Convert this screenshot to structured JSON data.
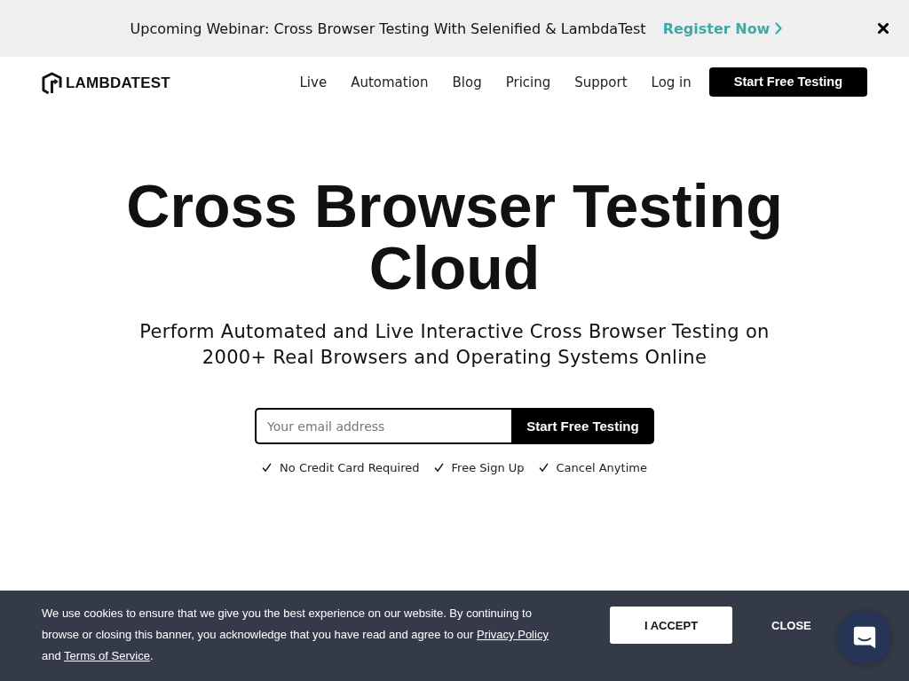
{
  "announcement_bar": {
    "text": "Upcoming Webinar: Cross Browser Testing With Selenified & LambdaTest",
    "link": "Register Now"
  },
  "header": {
    "logo": "LAMBDATEST",
    "nav": [
      {
        "label": "Live"
      },
      {
        "label": "Automation"
      },
      {
        "label": "Blog"
      },
      {
        "label": "Pricing"
      },
      {
        "label": "Support"
      },
      {
        "label": "Log in"
      }
    ],
    "cta": "Start Free Testing"
  },
  "hero": {
    "title": "Cross Browser Testing Cloud",
    "subtitle": "Perform Automated and Live Interactive Cross Browser Testing on 2000+ Real Browsers and Operating Systems Online",
    "signup": {
      "placeholder": "Your email address",
      "button": "Start Free Testing"
    },
    "perks": [
      "No Credit Card Required",
      "Free Sign Up",
      "Cancel Anytime"
    ]
  },
  "cookie_banner": {
    "text": [
      {
        "kind": "text",
        "text": "We use cookies to ensure that we give you the best experience on our website. By continuing to browse or closing this banner, you acknowledge that you have read and agree to our "
      },
      {
        "kind": "link",
        "text": "Privacy Policy"
      },
      {
        "kind": "text",
        "text": " and "
      },
      {
        "kind": "link",
        "text": "Terms of Service"
      },
      {
        "kind": "text",
        "text": "."
      }
    ],
    "accept": "I ACCEPT",
    "close": "CLOSE"
  }
}
